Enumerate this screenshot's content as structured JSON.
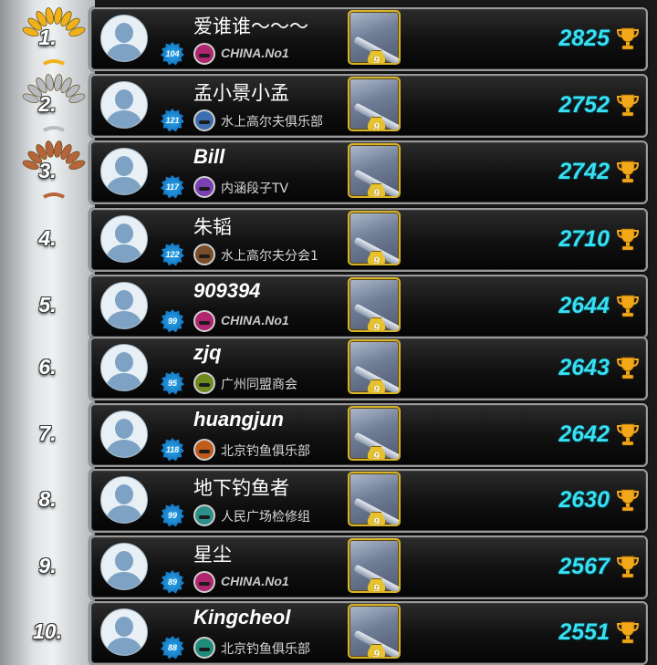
{
  "leaderboard": [
    {
      "rank": "1.",
      "name": "爱谁谁～～～",
      "name_style": "cjk",
      "level": "104",
      "club": "CHINA.No1",
      "club_style": "latin",
      "club_color": "#b0266e",
      "cue_level": "9",
      "score": "2825",
      "medal": "gold"
    },
    {
      "rank": "2.",
      "name": "孟小景小孟",
      "name_style": "cjk",
      "level": "121",
      "club": "水上高尔夫俱乐部",
      "club_style": "cjk",
      "club_color": "#3d6fb0",
      "cue_level": "9",
      "score": "2752",
      "medal": "silver"
    },
    {
      "rank": "3.",
      "name": "Bill",
      "name_style": "latin",
      "level": "117",
      "club": "内涵段子TV",
      "club_style": "cjk",
      "club_color": "#7b3fb4",
      "cue_level": "9",
      "score": "2742",
      "medal": "bronze"
    },
    {
      "rank": "4.",
      "name": "朱韬",
      "name_style": "cjk",
      "level": "122",
      "club": "水上高尔夫分会1",
      "club_style": "cjk",
      "club_color": "#7a4e2a",
      "cue_level": "9",
      "score": "2710",
      "medal": "none"
    },
    {
      "rank": "5.",
      "name": "909394",
      "name_style": "latin",
      "level": "99",
      "club": "CHINA.No1",
      "club_style": "latin",
      "club_color": "#b0266e",
      "cue_level": "9",
      "score": "2644",
      "medal": "none"
    },
    {
      "rank": "6.",
      "name": "zjq",
      "name_style": "latin",
      "level": "95",
      "club": "广州同盟商会",
      "club_style": "cjk",
      "club_color": "#6f8a1e",
      "cue_level": "9",
      "score": "2643",
      "medal": "none"
    },
    {
      "rank": "7.",
      "name": "huangjun",
      "name_style": "latin",
      "level": "118",
      "club": "北京钓鱼俱乐部",
      "club_style": "cjk",
      "club_color": "#c25a1c",
      "cue_level": "9",
      "score": "2642",
      "medal": "none"
    },
    {
      "rank": "8.",
      "name": "地下钓鱼者",
      "name_style": "cjk",
      "level": "99",
      "club": "人民广场检修组",
      "club_style": "cjk",
      "club_color": "#2c8f8a",
      "cue_level": "9",
      "score": "2630",
      "medal": "none"
    },
    {
      "rank": "9.",
      "name": "星尘",
      "name_style": "cjk",
      "level": "89",
      "club": "CHINA.No1",
      "club_style": "latin",
      "club_color": "#b0266e",
      "cue_level": "9",
      "score": "2567",
      "medal": "none"
    },
    {
      "rank": "10.",
      "name": "Kingcheol",
      "name_style": "latin",
      "level": "88",
      "club": "北京钓鱼俱乐部",
      "club_style": "cjk",
      "club_color": "#1f8c7a",
      "cue_level": "9",
      "score": "2551",
      "medal": "none"
    }
  ],
  "icons": {
    "avatar": "default-avatar-icon",
    "level": "level-star-badge-icon",
    "club": "club-emblem-icon",
    "cue": "cue-item-icon",
    "trophy": "trophy-icon",
    "medal": "laurel-wreath-icon"
  },
  "colors": {
    "score": "#37e0f3",
    "gold": "#f0b21a",
    "silver": "#b7bcc2",
    "bronze": "#b8643a",
    "trophy": "#f3a81a"
  }
}
